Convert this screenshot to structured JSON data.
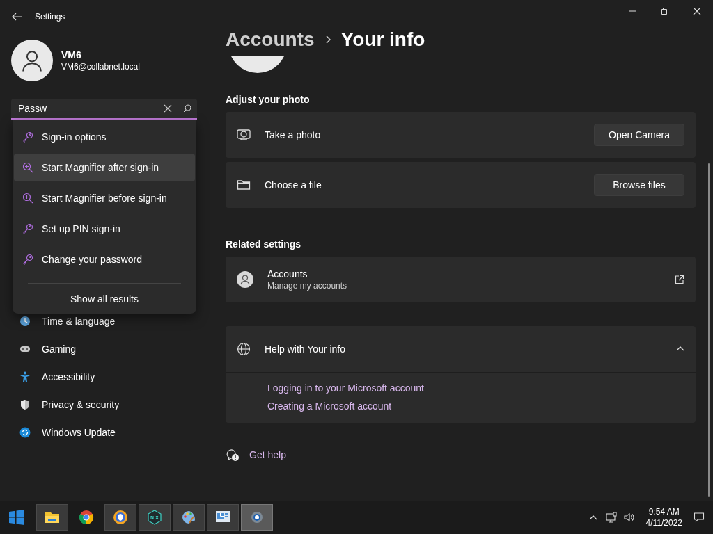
{
  "window": {
    "title": "Settings"
  },
  "profile": {
    "name": "VM6",
    "email": "VM6@collabnet.local"
  },
  "search": {
    "value": "Passw"
  },
  "search_results": [
    {
      "label": "Sign-in options",
      "kind": "key",
      "selected": false
    },
    {
      "label": "Start Magnifier after sign-in",
      "kind": "magnifier",
      "selected": true
    },
    {
      "label": "Start Magnifier before sign-in",
      "kind": "magnifier",
      "selected": false
    },
    {
      "label": "Set up PIN sign-in",
      "kind": "key",
      "selected": false
    },
    {
      "label": "Change your password",
      "kind": "key",
      "selected": false
    }
  ],
  "show_all": "Show all results",
  "sidebar": {
    "items": [
      {
        "label": "Time & language",
        "kind": "time"
      },
      {
        "label": "Gaming",
        "kind": "gaming"
      },
      {
        "label": "Accessibility",
        "kind": "accessibility"
      },
      {
        "label": "Privacy & security",
        "kind": "privacy"
      },
      {
        "label": "Windows Update",
        "kind": "update"
      }
    ]
  },
  "breadcrumb": {
    "parent": "Accounts",
    "current": "Your info"
  },
  "adjust_photo": {
    "heading": "Adjust your photo",
    "rows": [
      {
        "kind": "camera",
        "label": "Take a photo",
        "button": "Open Camera"
      },
      {
        "kind": "folder",
        "label": "Choose a file",
        "button": "Browse files"
      }
    ]
  },
  "related": {
    "heading": "Related settings",
    "rows": [
      {
        "title": "Accounts",
        "subtitle": "Manage my accounts"
      }
    ]
  },
  "help": {
    "title": "Help with Your info",
    "expanded": true,
    "links": [
      "Logging in to your Microsoft account",
      "Creating a Microsoft account"
    ]
  },
  "get_help": "Get help",
  "taskbar": {
    "apps": [
      {
        "kind": "explorer",
        "running": true,
        "selected": false
      },
      {
        "kind": "chrome",
        "running": false,
        "selected": false
      },
      {
        "kind": "shield-browser",
        "running": true,
        "selected": false
      },
      {
        "kind": "nox",
        "running": true,
        "selected": false
      },
      {
        "kind": "paint",
        "running": true,
        "selected": false
      },
      {
        "kind": "monitor",
        "running": true,
        "selected": false
      },
      {
        "kind": "settings",
        "running": true,
        "selected": true
      }
    ],
    "clock": {
      "time": "9:54 AM",
      "date": "4/11/2022"
    }
  }
}
